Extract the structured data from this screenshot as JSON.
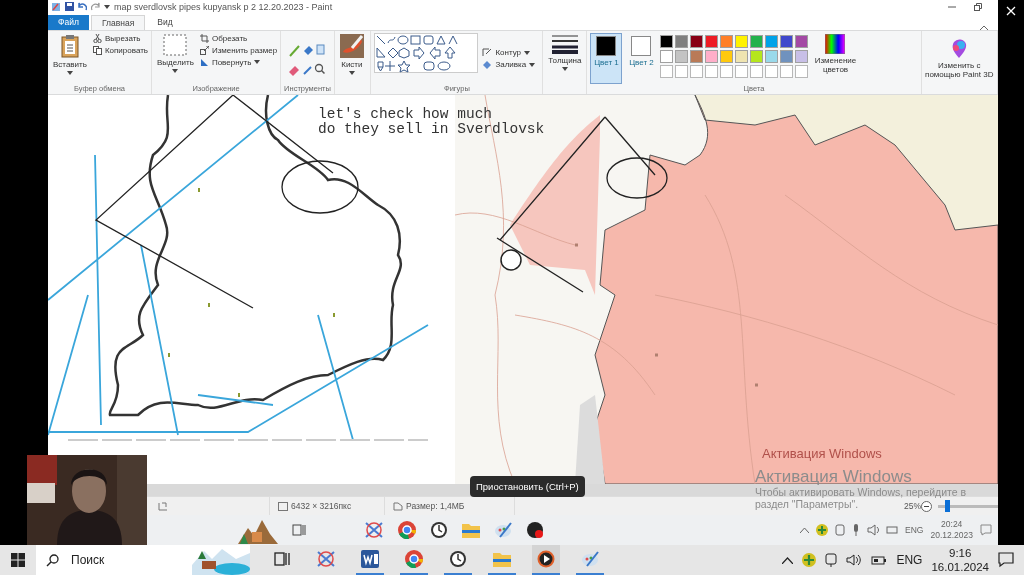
{
  "window": {
    "title": "map sverdlovsk pipes kupyansk p 2 12.20.2023 - Paint"
  },
  "tabs": [
    {
      "label": "Файл",
      "selected": false
    },
    {
      "label": "Главная",
      "selected": true
    },
    {
      "label": "Вид",
      "selected": false
    }
  ],
  "clipboard": {
    "label": "Буфер обмена",
    "paste": "Вставить",
    "cut": "Вырезать",
    "copy": "Копировать"
  },
  "image": {
    "label": "Изображение",
    "select": "Выделить",
    "crop": "Обрезать",
    "resize": "Изменить размер",
    "rotate": "Повернуть"
  },
  "tools": {
    "label": "Инструменты"
  },
  "brushes": {
    "label": "Кисти"
  },
  "shapes": {
    "label": "Фигуры",
    "outline": "Контур",
    "fill": "Заливка"
  },
  "size": {
    "label": "Толщина"
  },
  "colors": {
    "label": "Цвета",
    "edit": "Изменение цветов",
    "slots": [
      {
        "label": "Цвет 1",
        "color": "#000000",
        "selected": true
      },
      {
        "label": "Цвет 2",
        "color": "#ffffff",
        "selected": false
      }
    ],
    "palette": [
      {
        "color": "#000000"
      },
      {
        "color": "#7f7f7f"
      },
      {
        "color": "#880015"
      },
      {
        "color": "#ed1c24"
      },
      {
        "color": "#ff7f27"
      },
      {
        "color": "#fff200"
      },
      {
        "color": "#22b14c"
      },
      {
        "color": "#00a2e8"
      },
      {
        "color": "#3f48cc"
      },
      {
        "color": "#a349a4"
      },
      {
        "color": "#ffffff"
      },
      {
        "color": "#c3c3c3"
      },
      {
        "color": "#b97a57"
      },
      {
        "color": "#ffaec9"
      },
      {
        "color": "#ffc90e"
      },
      {
        "color": "#efe4b0"
      },
      {
        "color": "#b5e61d"
      },
      {
        "color": "#99d9ea"
      },
      {
        "color": "#7092be"
      },
      {
        "color": "#c8bfe7"
      },
      {
        "kind": "empty"
      },
      {
        "kind": "empty"
      },
      {
        "kind": "empty"
      },
      {
        "kind": "empty"
      },
      {
        "kind": "empty"
      },
      {
        "kind": "empty"
      },
      {
        "kind": "empty"
      },
      {
        "kind": "empty"
      },
      {
        "kind": "empty"
      },
      {
        "kind": "empty"
      }
    ]
  },
  "paint3d": {
    "label": "Изменить с помощью Paint 3D"
  },
  "canvas": {
    "annotation": [
      "let's check how much",
      "do they sell in Sverdlovsk"
    ]
  },
  "status_bar": {
    "dimensions": "6432 × 3216пкс",
    "size": "Размер: 1,4МБ",
    "zoom": "25%",
    "zoom_slider": {
      "level": 0.12
    }
  },
  "recorded_taskbar": {
    "language": "ENG",
    "time": "20:24",
    "date": "20.12.2023"
  },
  "tooltip": "Приостановить (Ctrl+P)",
  "recorded_activation": {
    "title": "Активация Windows"
  },
  "activation": {
    "title": "Активация Windows",
    "text_lines": [
      "Чтобы активировать Windows, перейдите в",
      "раздел \"Параметры\"."
    ]
  },
  "taskbar": {
    "search": {
      "placeholder": "Поиск"
    },
    "language": "ENG",
    "time": "9:16",
    "date": "16.01.2024"
  }
}
